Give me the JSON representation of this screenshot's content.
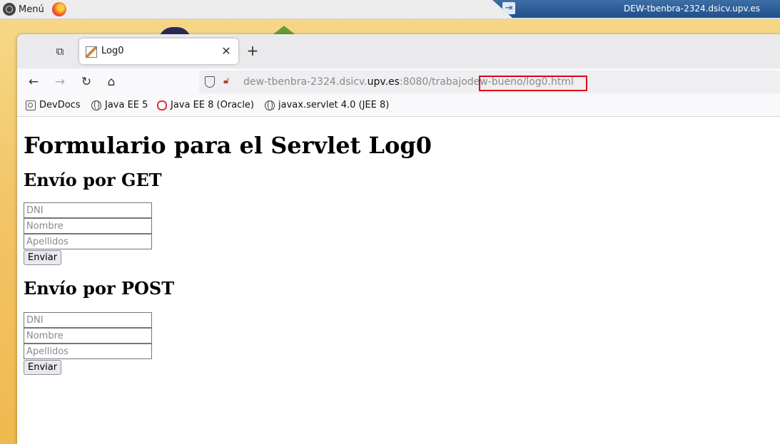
{
  "panel": {
    "menu_label": "Menú",
    "window_title": "DEW-tbenbra-2324.dsicv.upv.es"
  },
  "browser": {
    "tab": {
      "title": "Log0"
    },
    "url": {
      "prefix": "dew-tbenbra-2324.dsicv.",
      "host": "upv.es",
      "suffix": ":8080/trabajodew-bueno/log0.html"
    },
    "bookmarks": [
      {
        "label": "DevDocs",
        "icon": "devdocs-icon"
      },
      {
        "label": "Java EE 5",
        "icon": "globe-icon"
      },
      {
        "label": "Java EE 8 (Oracle)",
        "icon": "oracle-icon"
      },
      {
        "label": "javax.servlet 4.0 (JEE 8)",
        "icon": "globe-icon"
      }
    ],
    "highlight_color": "#e3001b"
  },
  "page": {
    "title": "Formulario para el Servlet Log0",
    "get_section": {
      "heading": "Envío por GET",
      "dni_placeholder": "DNI",
      "nombre_placeholder": "Nombre",
      "apellidos_placeholder": "Apellidos",
      "submit_label": "Enviar"
    },
    "post_section": {
      "heading": "Envío por POST",
      "dni_placeholder": "DNI",
      "nombre_placeholder": "Nombre",
      "apellidos_placeholder": "Apellidos",
      "submit_label": "Enviar"
    }
  }
}
